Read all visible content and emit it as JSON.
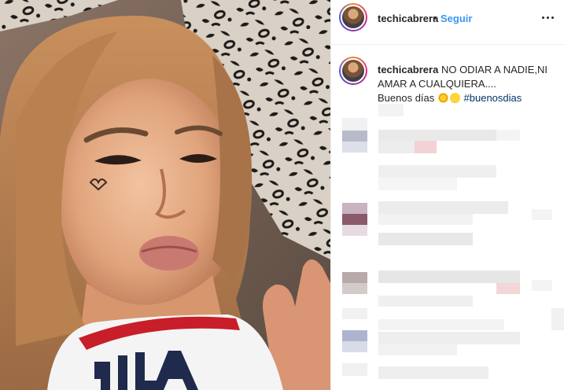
{
  "post": {
    "username": "techicabrera",
    "follow_label": "Seguir",
    "separator": "•",
    "more_icon": "more-options-icon"
  },
  "caption": {
    "username": "techicabrera",
    "text": "NO ODIAR A NADIE,NI AMAR A CUALQUIERA....",
    "line2": "Buenos días",
    "emojis": [
      "sun-emoji",
      "smile-emoji"
    ],
    "hashtag": "#buenosdias"
  },
  "colors": {
    "link": "#3897f0",
    "hashtag": "#003569",
    "text": "#262626",
    "border": "#efefef"
  }
}
